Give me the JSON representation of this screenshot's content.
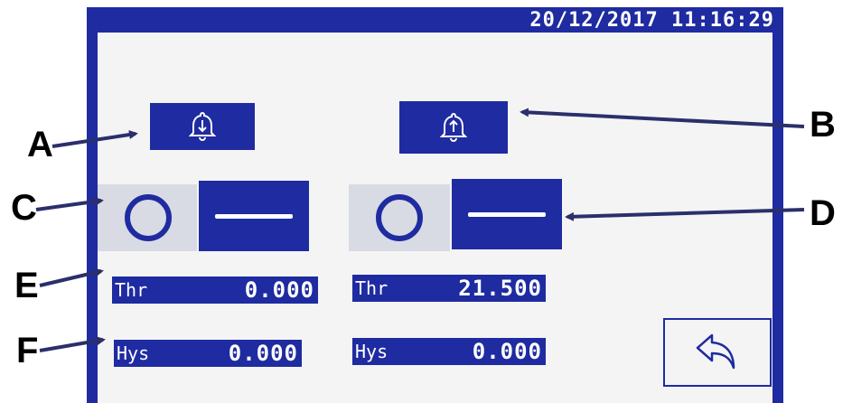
{
  "header": {
    "datetime": "20/12/2017   11:16:29"
  },
  "alarms": {
    "low": {
      "icon": "bell-down-arrow-icon"
    },
    "high": {
      "icon": "bell-up-arrow-icon"
    }
  },
  "columns": [
    {
      "thr_label": "Thr",
      "thr_value": "0.000",
      "hys_label": "Hys",
      "hys_value": "0.000"
    },
    {
      "thr_label": "Thr",
      "thr_value": "21.500",
      "hys_label": "Hys",
      "hys_value": "0.000"
    }
  ],
  "back_button": {
    "icon": "back-arrow-icon"
  },
  "callouts": [
    "A",
    "B",
    "C",
    "D",
    "E",
    "F"
  ],
  "colors": {
    "screen_blue": "#1f2ba0",
    "panel": "#f4f4f4",
    "text_on_blue": "#ffffff",
    "arrow": "#2b2f6b"
  }
}
